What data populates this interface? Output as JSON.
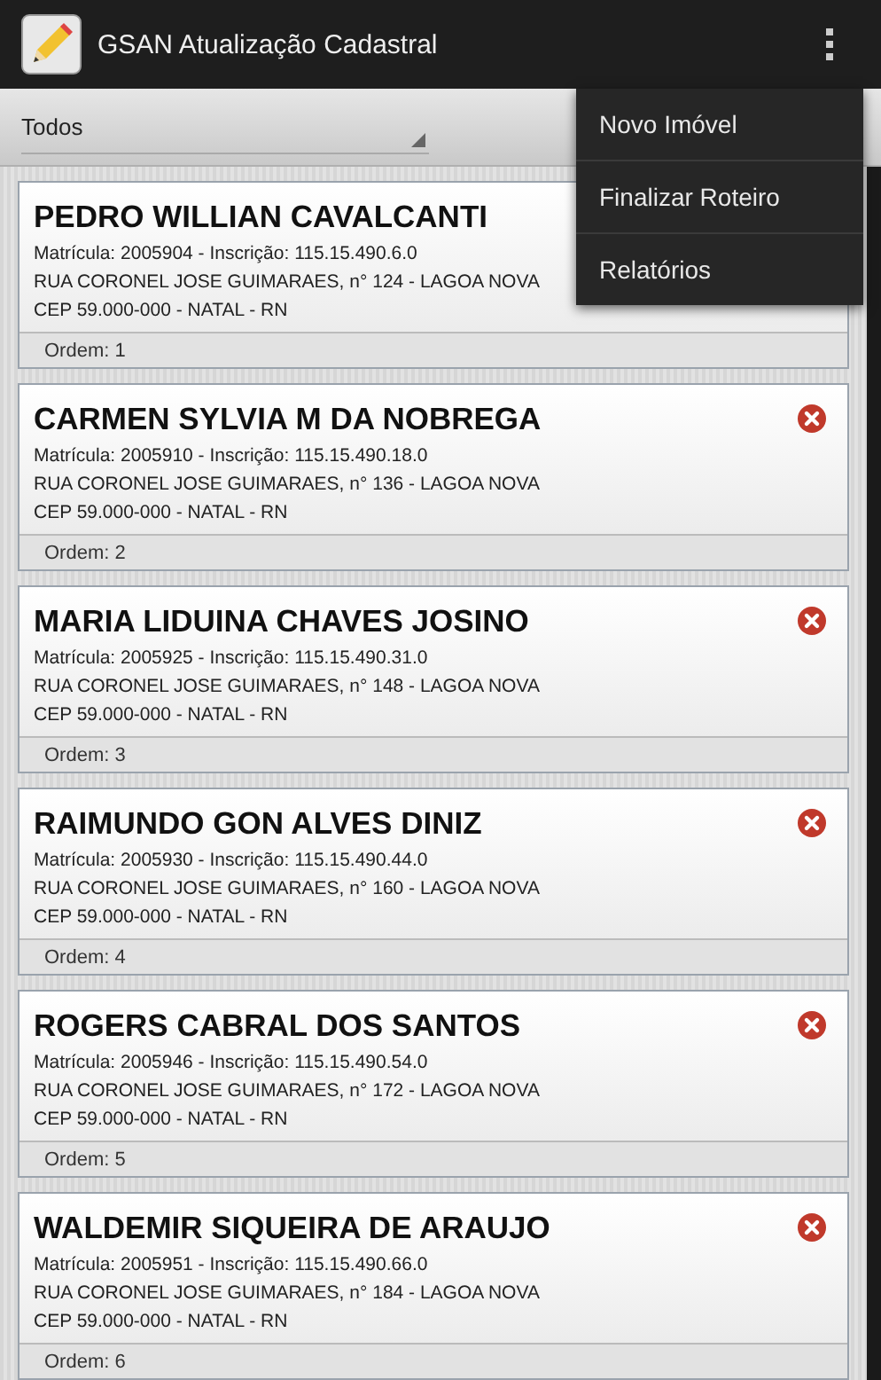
{
  "action_bar": {
    "title": "GSAN Atualização Cadastral"
  },
  "filter": {
    "value": "Todos"
  },
  "menu": {
    "items": [
      {
        "label": "Novo Imóvel"
      },
      {
        "label": "Finalizar Roteiro"
      },
      {
        "label": "Relatórios"
      }
    ]
  },
  "cards": [
    {
      "name": "PEDRO WILLIAN CAVALCANTI",
      "ids": "Matrícula: 2005904  -  Inscrição: 115.15.490.6.0",
      "address": "RUA CORONEL JOSE GUIMARAES, n° 124 - LAGOA NOVA",
      "city": "CEP 59.000-000 - NATAL - RN",
      "order": "Ordem: 1",
      "remove_icon": false
    },
    {
      "name": "CARMEN SYLVIA M DA NOBREGA",
      "ids": "Matrícula: 2005910  -  Inscrição: 115.15.490.18.0",
      "address": "RUA CORONEL JOSE GUIMARAES, n° 136 - LAGOA NOVA",
      "city": "CEP 59.000-000 - NATAL - RN",
      "order": "Ordem: 2",
      "remove_icon": true
    },
    {
      "name": "MARIA LIDUINA CHAVES JOSINO",
      "ids": "Matrícula: 2005925  -  Inscrição: 115.15.490.31.0",
      "address": "RUA CORONEL JOSE GUIMARAES, n° 148 - LAGOA NOVA",
      "city": "CEP 59.000-000 - NATAL - RN",
      "order": "Ordem: 3",
      "remove_icon": true
    },
    {
      "name": "RAIMUNDO GON ALVES DINIZ",
      "ids": "Matrícula: 2005930  -  Inscrição: 115.15.490.44.0",
      "address": "RUA CORONEL JOSE GUIMARAES, n° 160 - LAGOA NOVA",
      "city": "CEP 59.000-000 - NATAL - RN",
      "order": "Ordem: 4",
      "remove_icon": true
    },
    {
      "name": "ROGERS CABRAL DOS SANTOS",
      "ids": "Matrícula: 2005946  -  Inscrição: 115.15.490.54.0",
      "address": "RUA CORONEL JOSE GUIMARAES, n° 172 - LAGOA NOVA",
      "city": "CEP 59.000-000 - NATAL - RN",
      "order": "Ordem: 5",
      "remove_icon": true
    },
    {
      "name": "WALDEMIR SIQUEIRA DE ARAUJO",
      "ids": "Matrícula: 2005951  -  Inscrição: 115.15.490.66.0",
      "address": "RUA CORONEL JOSE GUIMARAES, n° 184 - LAGOA NOVA",
      "city": "CEP 59.000-000 - NATAL - RN",
      "order": "Ordem: 6",
      "remove_icon": true
    }
  ]
}
